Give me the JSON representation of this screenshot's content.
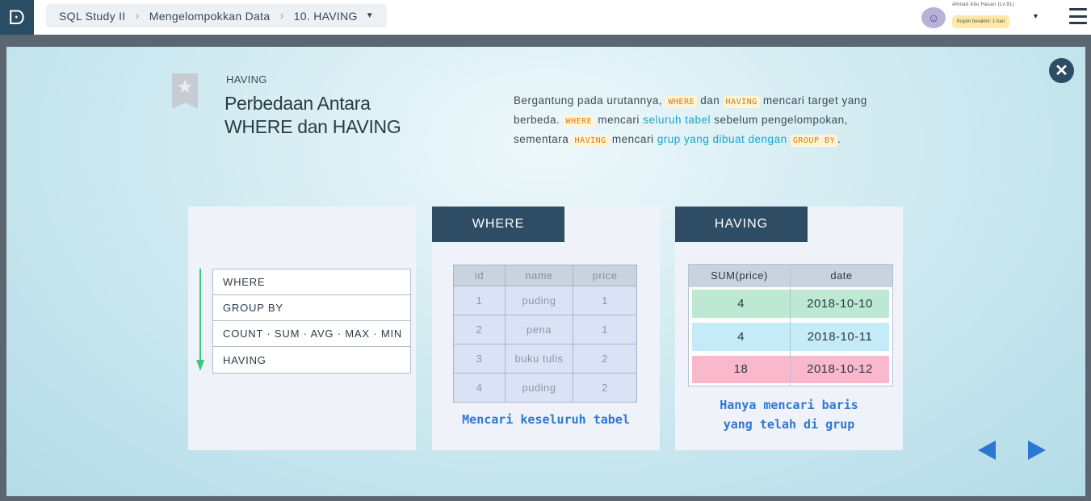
{
  "app": {
    "logo_glyph": "ᗠ"
  },
  "breadcrumb": {
    "course": "SQL Study II",
    "chapter": "Mengelompokkan Data",
    "lesson": "10. HAVING"
  },
  "user": {
    "name": "Ahmad Abu Hasan (Lv.91)",
    "coupon": "Kupon berakhir: 1 hari"
  },
  "slide": {
    "tag": "HAVING",
    "title": "Perbedaan Antara WHERE dan HAVING",
    "desc": {
      "p1": "Bergantung pada urutannya, ",
      "code1": "WHERE",
      "p2": " dan ",
      "code2": "HAVING",
      "p3": " mencari target yang berbeda. ",
      "code3": "WHERE",
      "p4": " mencari ",
      "hl1": "seluruh tabel",
      "p5": " sebelum pengelompokan, sementara ",
      "code4": "HAVING",
      "p6": " mencari ",
      "hl2": "grup yang dibuat dengan",
      "p7": " ",
      "code5": "GROUP BY",
      "p8": "."
    },
    "order": [
      "WHERE",
      "GROUP BY",
      "COUNT · SUM · AVG · MAX · MIN",
      "HAVING"
    ],
    "where_panel": {
      "title": "WHERE",
      "columns": [
        "id",
        "name",
        "price"
      ],
      "rows": [
        [
          "1",
          "puding",
          "1"
        ],
        [
          "2",
          "pena",
          "1"
        ],
        [
          "3",
          "buku tulis",
          "2"
        ],
        [
          "4",
          "puding",
          "2"
        ]
      ],
      "caption": "Mencari keseluruh tabel"
    },
    "having_panel": {
      "title": "HAVING",
      "columns": [
        "SUM(price)",
        "date"
      ],
      "rows": [
        [
          "4",
          "2018-10-10"
        ],
        [
          "4",
          "2018-10-11"
        ],
        [
          "18",
          "2018-10-12"
        ]
      ],
      "row_colors": [
        "#bde9d2",
        "#c4ecf8",
        "#f9b8cb"
      ],
      "caption_line1": "Hanya mencari baris",
      "caption_line2": "yang telah di grup"
    }
  },
  "colors": {
    "accent_dark": "#2e4c63",
    "link_blue": "#2d77d4",
    "highlight_cyan": "#14a5d0",
    "code_orange": "#d27b12",
    "arrow_green": "#3cc77c"
  },
  "icons": {
    "close": "close-icon",
    "bookmark": "bookmark-star-icon",
    "menu": "hamburger-menu-icon",
    "prev": "prev-arrow-icon",
    "next": "next-arrow-icon"
  }
}
